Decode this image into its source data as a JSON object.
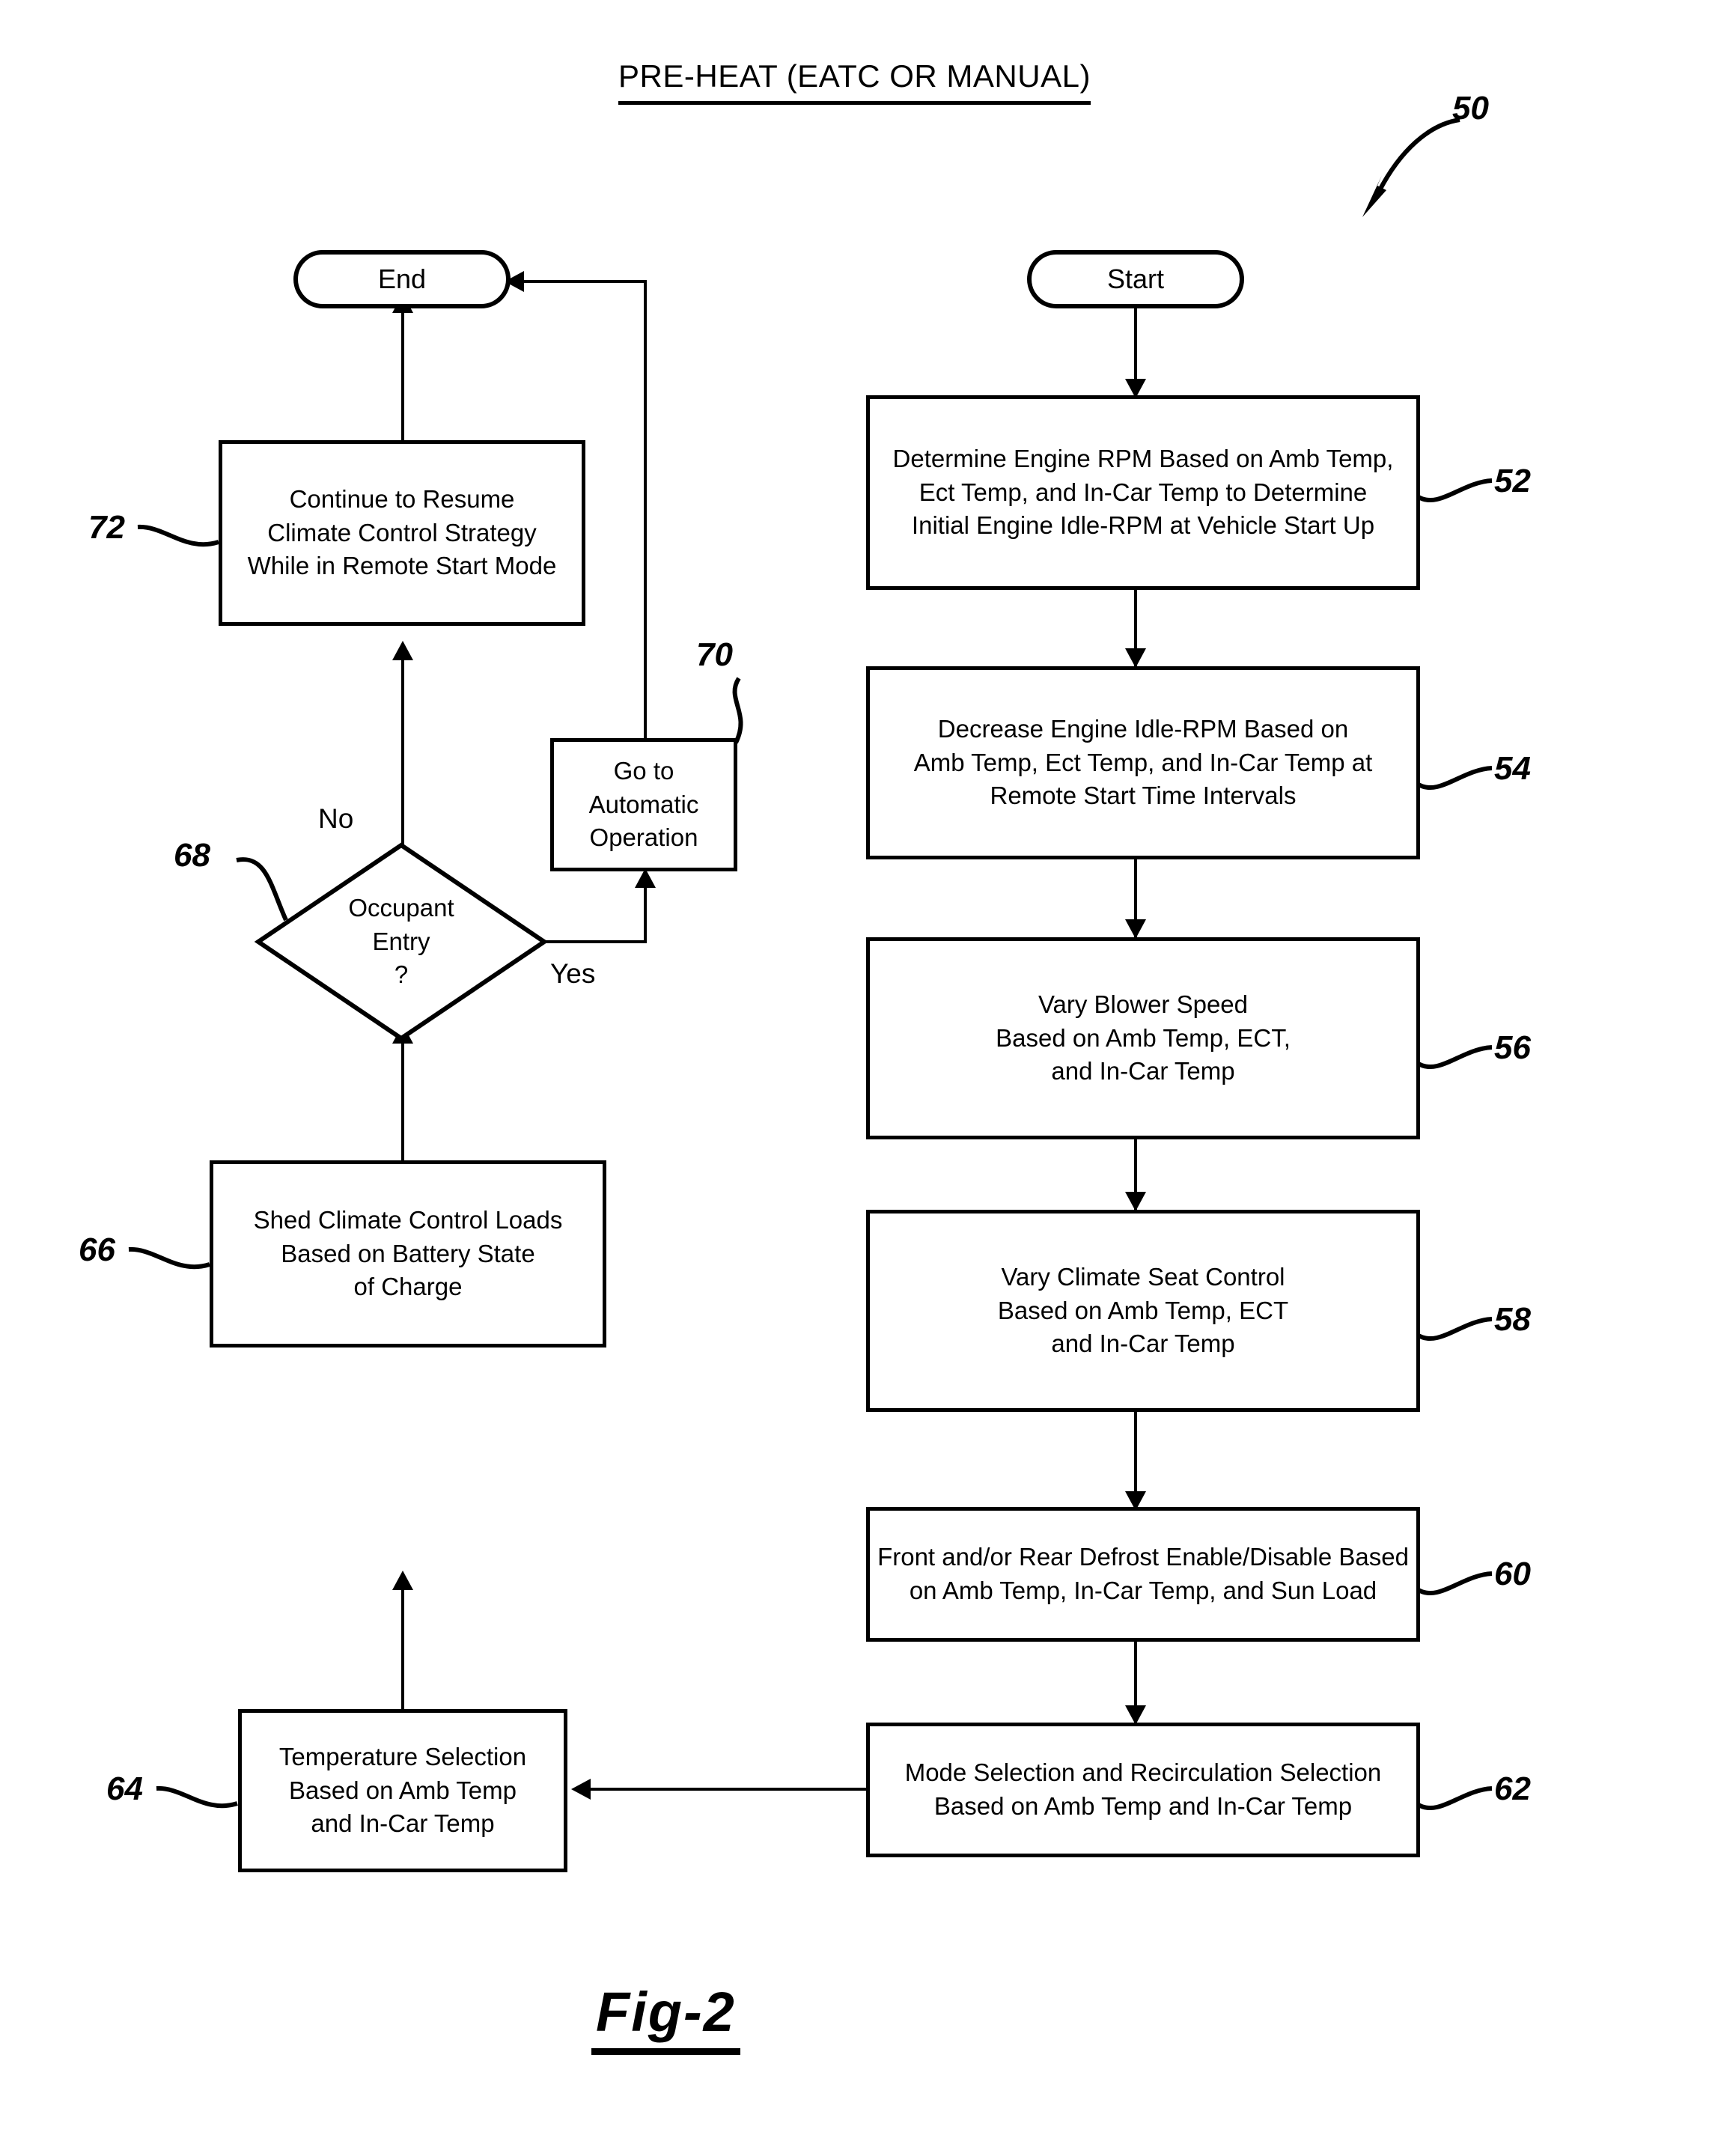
{
  "figure": {
    "title": "PRE-HEAT (EATC  OR  MANUAL)",
    "caption": "Fig-2",
    "main_reference": "50"
  },
  "nodes": {
    "start": {
      "label": "Start",
      "shape": "terminator"
    },
    "end": {
      "label": "End",
      "shape": "terminator"
    },
    "n52": {
      "ref": "52",
      "lines": [
        "Determine Engine RPM Based on Amb Temp,",
        "Ect Temp, and In-Car Temp to Determine",
        "Initial Engine Idle-RPM at Vehicle Start Up"
      ]
    },
    "n54": {
      "ref": "54",
      "lines": [
        "Decrease Engine Idle-RPM Based on",
        "Amb Temp, Ect Temp, and In-Car Temp at",
        "Remote Start Time Intervals"
      ]
    },
    "n56": {
      "ref": "56",
      "lines": [
        "Vary Blower Speed",
        "Based on Amb Temp, ECT,",
        "and In-Car Temp"
      ]
    },
    "n58": {
      "ref": "58",
      "lines": [
        "Vary Climate Seat Control",
        "Based on Amb Temp, ECT",
        "and In-Car Temp"
      ]
    },
    "n60": {
      "ref": "60",
      "lines": [
        "Front and/or Rear Defrost Enable/Disable Based",
        "on Amb Temp, In-Car Temp, and Sun Load"
      ]
    },
    "n62": {
      "ref": "62",
      "lines": [
        "Mode Selection and Recirculation Selection",
        "Based on Amb Temp and In-Car Temp"
      ]
    },
    "n64": {
      "ref": "64",
      "lines": [
        "Temperature Selection",
        "Based on Amb Temp",
        "and In-Car Temp"
      ]
    },
    "n66": {
      "ref": "66",
      "lines": [
        "Shed Climate Control Loads",
        "Based on Battery State",
        "of Charge"
      ]
    },
    "n68": {
      "ref": "68",
      "shape": "decision",
      "lines": [
        "Occupant",
        "Entry",
        "?"
      ],
      "branch_no": "No",
      "branch_yes": "Yes"
    },
    "n70": {
      "ref": "70",
      "lines": [
        "Go to",
        "Automatic",
        "Operation"
      ]
    },
    "n72": {
      "ref": "72",
      "lines": [
        "Continue to Resume",
        "Climate Control Strategy",
        "While in Remote Start Mode"
      ]
    }
  },
  "colors": {
    "ink": "#000000",
    "paper": "#ffffff"
  }
}
